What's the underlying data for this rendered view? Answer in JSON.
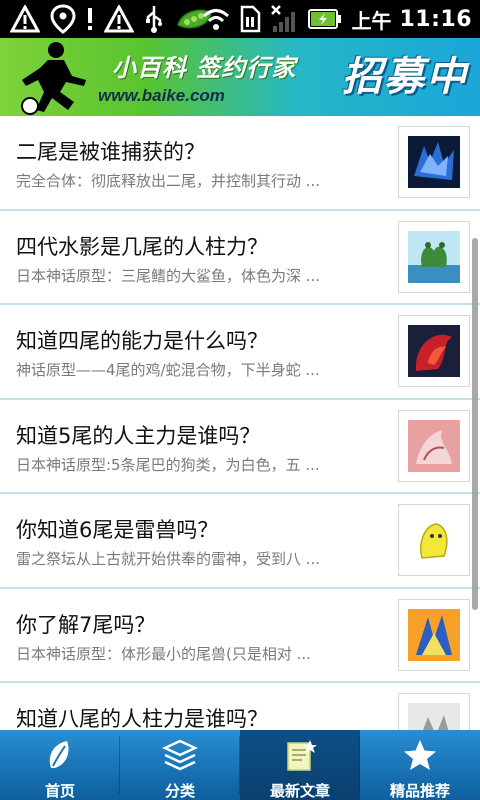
{
  "status_bar": {
    "time": "11:16",
    "ampm": "上午",
    "icons": [
      "warning-icon",
      "location-icon",
      "warning-icon",
      "usb-icon",
      "peas-icon",
      "wifi-icon",
      "sim-icon",
      "signal-icon",
      "battery-charging-icon"
    ]
  },
  "banner": {
    "slogan": "小百科 签约行家",
    "url": "www.baike.com",
    "recruit": "招募中"
  },
  "articles": [
    {
      "title": "二尾是被谁捕获的？",
      "desc": "完全合体：彻底释放出二尾，并控制其行动 ..."
    },
    {
      "title": "四代水影是几尾的人柱力？",
      "desc": "日本神话原型：三尾鳍的大鲨鱼，体色为深 ..."
    },
    {
      "title": "知道四尾的能力是什么吗？",
      "desc": "神话原型——4尾的鸡/蛇混合物，下半身蛇 ..."
    },
    {
      "title": "知道5尾的人主力是谁吗？",
      "desc": "日本神话原型:5条尾巴的狗类，为白色，五 ..."
    },
    {
      "title": "你知道6尾是雷兽吗？",
      "desc": "雷之祭坛从上古就开始供奉的雷神，受到八 ..."
    },
    {
      "title": "你了解7尾吗？",
      "desc": "日本神话原型：体形最小的尾兽(只是相对 ..."
    },
    {
      "title": "知道八尾的人柱力是谁吗？",
      "desc": ""
    }
  ],
  "tabs": [
    {
      "label": "首页",
      "icon": "leaf-icon",
      "active": false
    },
    {
      "label": "分类",
      "icon": "layers-icon",
      "active": false
    },
    {
      "label": "最新文章",
      "icon": "new-document-icon",
      "active": true
    },
    {
      "label": "精品推荐",
      "icon": "star-icon",
      "active": false
    }
  ],
  "colors": {
    "tab_bar": "#1976b8",
    "tab_active": "#0a4070",
    "row_divider": "#bfe4ee",
    "title_text": "#111111",
    "desc_text": "#7a7a7a"
  }
}
